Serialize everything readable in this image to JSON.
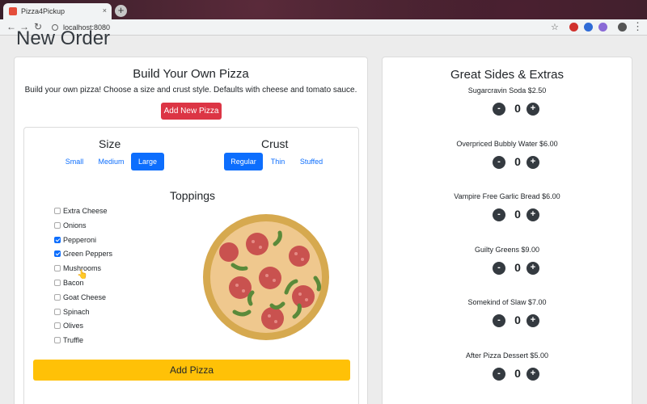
{
  "browser": {
    "tab_title": "Pizza4Pickup",
    "tab_close": "×",
    "new_tab": "+",
    "url": "localhost:8080",
    "back": "←",
    "forward": "→",
    "reload": "↻",
    "star": "☆",
    "menu": "⋮"
  },
  "page": {
    "title": "New Order"
  },
  "builder": {
    "heading": "Build Your Own Pizza",
    "description": "Build your own pizza! Choose a size and crust style. Defaults with cheese and tomato sauce.",
    "add_new_label": "Add New Pizza",
    "size": {
      "title": "Size",
      "options": [
        {
          "label": "Small",
          "active": false
        },
        {
          "label": "Medium",
          "active": false
        },
        {
          "label": "Large",
          "active": true
        }
      ]
    },
    "crust": {
      "title": "Crust",
      "options": [
        {
          "label": "Regular",
          "active": true
        },
        {
          "label": "Thin",
          "active": false
        },
        {
          "label": "Stuffed",
          "active": false
        }
      ]
    },
    "toppings": {
      "title": "Toppings",
      "items": [
        {
          "label": "Extra Cheese",
          "checked": false
        },
        {
          "label": "Onions",
          "checked": false
        },
        {
          "label": "Pepperoni",
          "checked": true
        },
        {
          "label": "Green Peppers",
          "checked": true
        },
        {
          "label": "Mushrooms",
          "checked": false
        },
        {
          "label": "Bacon",
          "checked": false
        },
        {
          "label": "Goat Cheese",
          "checked": false
        },
        {
          "label": "Spinach",
          "checked": false
        },
        {
          "label": "Olives",
          "checked": false
        },
        {
          "label": "Truffle",
          "checked": false
        }
      ]
    },
    "add_pizza_label": "Add Pizza"
  },
  "sides": {
    "heading": "Great Sides & Extras",
    "items": [
      {
        "label": "Sugarcravin Soda $2.50",
        "qty": "0"
      },
      {
        "label": "Overpriced Bubbly Water $6.00",
        "qty": "0"
      },
      {
        "label": "Vampire Free Garlic Bread $6.00",
        "qty": "0"
      },
      {
        "label": "Guilty Greens $9.00",
        "qty": "0"
      },
      {
        "label": "Somekind of Slaw $7.00",
        "qty": "0"
      },
      {
        "label": "After Pizza Dessert $5.00",
        "qty": "0"
      }
    ],
    "minus": "-",
    "plus": "+"
  },
  "colors": {
    "primary": "#0d6efd",
    "danger": "#dc3545",
    "warning": "#ffc107",
    "dark": "#343a40",
    "crust": "#d6a94f",
    "cheese": "#efc88e",
    "pepperoni": "#c9524f",
    "pepper": "#5a8a3a"
  }
}
